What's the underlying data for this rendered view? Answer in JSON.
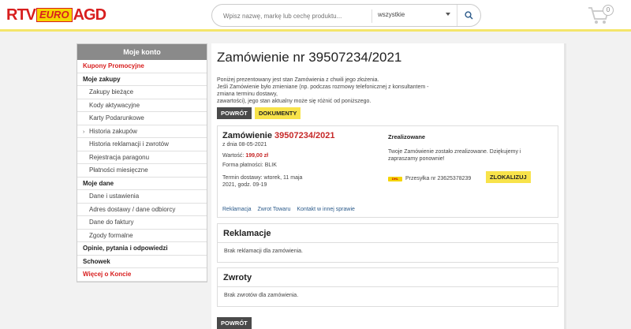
{
  "header": {
    "logo": {
      "rtv": "RTV",
      "euro": "EURO",
      "agd": "AGD"
    },
    "search": {
      "placeholder": "Wpisz nazwę, markę lub cechę produktu...",
      "category": "wszystkie"
    },
    "cart": {
      "count": "0"
    }
  },
  "sidebar": {
    "title": "Moje konto",
    "items": [
      {
        "label": "Kupony Promocyjne",
        "type": "red"
      },
      {
        "label": "Moje zakupy",
        "type": "section"
      },
      {
        "label": "Zakupy bieżące",
        "type": "sub"
      },
      {
        "label": "Kody aktywacyjne",
        "type": "sub"
      },
      {
        "label": "Karty Podarunkowe",
        "type": "sub"
      },
      {
        "label": "Historia zakupów",
        "type": "arrow"
      },
      {
        "label": "Historia reklamacji i zwrotów",
        "type": "sub"
      },
      {
        "label": "Rejestracja paragonu",
        "type": "sub"
      },
      {
        "label": "Płatności miesięczne",
        "type": "sub"
      },
      {
        "label": "Moje dane",
        "type": "section"
      },
      {
        "label": "Dane i ustawienia",
        "type": "sub"
      },
      {
        "label": "Adres dostawy / dane odbiorcy",
        "type": "sub"
      },
      {
        "label": "Dane do faktury",
        "type": "sub"
      },
      {
        "label": "Zgody formalne",
        "type": "sub"
      },
      {
        "label": "Opinie, pytania i odpowiedzi",
        "type": "section"
      },
      {
        "label": "Schowek",
        "type": "section"
      },
      {
        "label": "Więcej o Koncie",
        "type": "red"
      }
    ]
  },
  "main": {
    "title": "Zamówienie nr 39507234/2021",
    "intro": [
      "Poniżej prezentowany jest stan Zamówienia z chwili jego złożenia.",
      "Jeśli Zamówienie było zmieniane (np. podczas rozmowy telefonicznej z konsultantem - zmiana terminu dostawy,",
      "zawartości), jego stan aktualny może się różnić od poniższego."
    ],
    "back_button": "POWRÓT",
    "documents_button": "DOKUMENTY",
    "order": {
      "heading_prefix": "Zamówienie",
      "number": "39507234/2021",
      "date": "z dnia 08-05-2021",
      "value_label": "Wartość:",
      "value": "199,00 zł",
      "payment_label": "Forma płatności:",
      "payment": "BLIK",
      "delivery_line1": "Termin dostawy: wtorek, 11 maja",
      "delivery_line2": "2021, godz. 09-19",
      "status_title": "Zrealizowane",
      "status_text": "Twoje Zamówienie zostało zrealizowane. Dziękujemy i zapraszamy ponownie!",
      "carrier_logo": "DHL",
      "shipment": "Przesyłka nr 23625378239",
      "locate_button": "ZLOKALIZUJ",
      "links": [
        "Reklamacja",
        "Zwrot Towaru",
        "Kontakt w innej sprawie"
      ]
    },
    "complaints": {
      "title": "Reklamacje",
      "text": "Brak reklamacji dla zamówienia."
    },
    "returns": {
      "title": "Zwroty",
      "text": "Brak zwrotów dla zamówienia."
    },
    "back_button_bottom": "POWRÓT"
  }
}
